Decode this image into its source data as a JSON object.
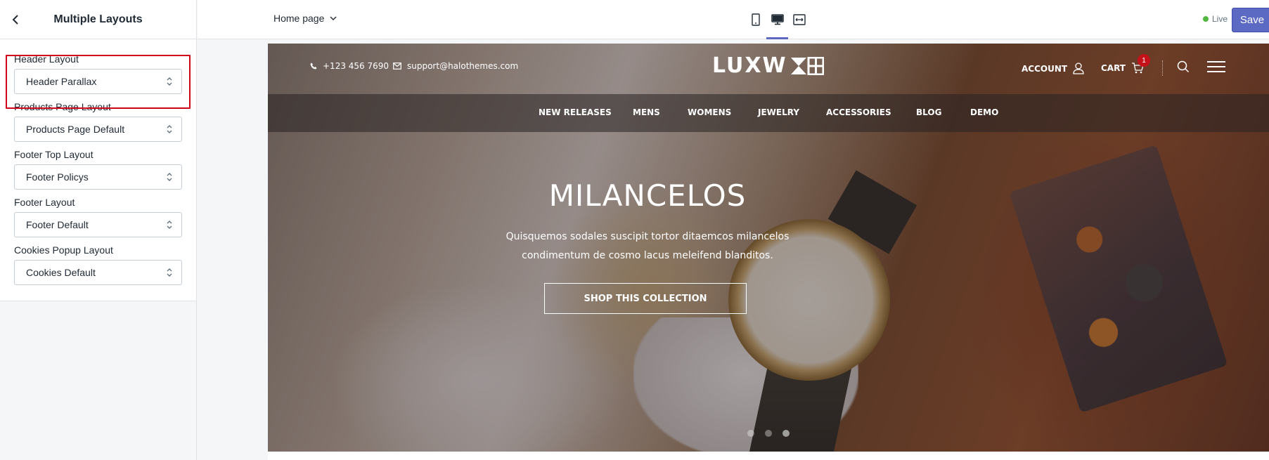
{
  "sidebar": {
    "title": "Multiple Layouts",
    "fields": [
      {
        "label": "Header Layout",
        "value": "Header Parallax"
      },
      {
        "label": "Products Page Layout",
        "value": "Products Page Default"
      },
      {
        "label": "Footer Top Layout",
        "value": "Footer Policys"
      },
      {
        "label": "Footer Layout",
        "value": "Footer Default"
      },
      {
        "label": "Cookies Popup Layout",
        "value": "Cookies Default"
      }
    ]
  },
  "topbar": {
    "page": "Home page",
    "devices": [
      "mobile-icon",
      "desktop-icon",
      "fullwidth-icon"
    ],
    "active_device": "desktop",
    "live": "Live",
    "save": "Save"
  },
  "store": {
    "phone": "+123 456 7690",
    "email": "support@halothemes.com",
    "logo": "LUXW",
    "account": "ACCOUNT",
    "cart": "CART",
    "cart_count": "1",
    "nav": [
      "NEW RELEASES",
      "MENS",
      "WOMENS",
      "JEWELRY",
      "ACCESSORIES",
      "BLOG",
      "DEMO"
    ],
    "hero": {
      "title": "MILANCELOS",
      "subtitle": "Quisquemos sodales suscipit tortor ditaemcos milancelos condimentum de cosmo lacus meleifend blanditos.",
      "button": "SHOP THIS COLLECTION",
      "slides": 3,
      "active_slide": 2
    }
  },
  "colors": {
    "accent": "#5c6ac4",
    "highlight": "#d0021b",
    "live": "#50b83c",
    "badge": "#c4111a"
  }
}
